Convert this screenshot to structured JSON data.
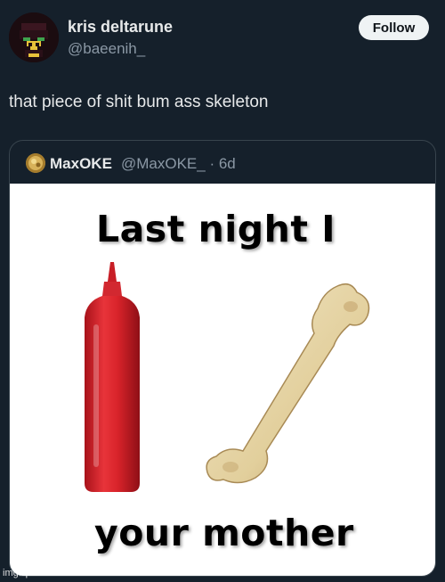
{
  "author": {
    "display_name": "kris deltarune",
    "handle": "@baeenih_"
  },
  "follow_button": {
    "label": "Follow"
  },
  "tweet": {
    "text": "that piece of shit bum ass skeleton"
  },
  "quoted_tweet": {
    "display_name": "MaxOKE",
    "meta": "@MaxOKE_ · 6d",
    "image": {
      "top_text": "Last night I",
      "bottom_text": "your mother"
    }
  },
  "watermark": "imgflip.com",
  "colors": {
    "background": "#15202b",
    "primary_text": "#e7e9ea",
    "secondary_text": "#8b98a5",
    "border": "#38444d",
    "follow_bg": "#eff3f4",
    "ketchup_red": "#d8232a"
  },
  "icons": {
    "author_avatar": "pixel-art-kris-avatar",
    "quoted_avatar": "gold-coin-avatar",
    "ketchup": "ketchup-bottle-picture",
    "bone": "femur-bone-picture"
  }
}
